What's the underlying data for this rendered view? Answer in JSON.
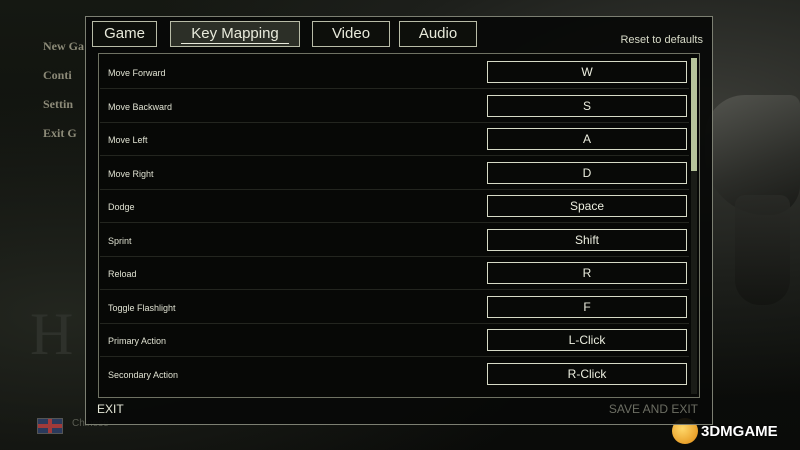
{
  "background_menu": [
    "New Ga",
    "Conti",
    "Settin",
    "Exit G"
  ],
  "background_logo": "H",
  "language_label": "Chinese",
  "watermark": "3DMGAME",
  "tabs": [
    {
      "label": "Game",
      "active": false
    },
    {
      "label": "Key Mapping",
      "active": true
    },
    {
      "label": "Video",
      "active": false
    },
    {
      "label": "Audio",
      "active": false
    }
  ],
  "reset_label": "Reset to defaults",
  "bindings": [
    {
      "action": "Move Forward",
      "key": "W"
    },
    {
      "action": "Move Backward",
      "key": "S"
    },
    {
      "action": "Move Left",
      "key": "A"
    },
    {
      "action": "Move Right",
      "key": "D"
    },
    {
      "action": "Dodge",
      "key": "Space"
    },
    {
      "action": "Sprint",
      "key": "Shift"
    },
    {
      "action": "Reload",
      "key": "R"
    },
    {
      "action": "Toggle Flashlight",
      "key": "F"
    },
    {
      "action": "Primary Action",
      "key": "L-Click"
    },
    {
      "action": "Secondary Action",
      "key": "R-Click"
    }
  ],
  "footer": {
    "exit_label": "EXIT",
    "save_label": "SAVE AND EXIT"
  },
  "colors": {
    "accent": "#b6c49a",
    "text": "#e0e2d2",
    "disabled": "#6c6e63"
  }
}
